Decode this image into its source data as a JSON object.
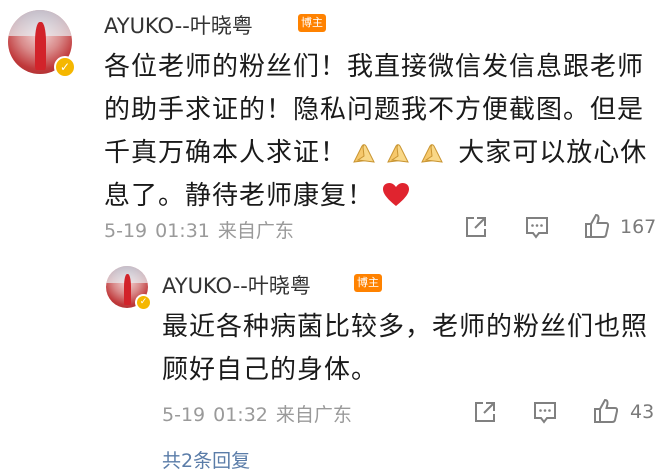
{
  "comment1": {
    "user_name": "AYUKO--叶晓粤",
    "badge": "博主",
    "verified_icon": "v-badge-icon",
    "lines": [
      "各位老师的粉丝们！我直接微信发信息跟老师",
      "的助手求证的！隐私问题我不方便截图。但是",
      "千真万确本人求证！",
      "大家可以放心休",
      "息了。静待老师康复！"
    ],
    "date": "5-19",
    "time": "01:31",
    "source": "来自广东",
    "likes": "167",
    "icons": [
      "share-icon",
      "comment-icon",
      "thumbs-up-icon",
      "pray-hands-emoji",
      "red-heart-emoji"
    ]
  },
  "reply1": {
    "user_name": "AYUKO--叶晓粤",
    "badge": "博主",
    "verified_icon": "v-badge-icon",
    "lines": [
      "最近各种病菌比较多，老师的粉丝们也照",
      "顾好自己的身体。"
    ],
    "date": "5-19",
    "time": "01:32",
    "source": "来自广东",
    "likes": "43"
  },
  "more_replies_label": "共2条回复",
  "colors": {
    "badge": "#ff8200",
    "verified": "#f5b700",
    "heart": "#e0242f",
    "link": "#5a7ca8"
  }
}
